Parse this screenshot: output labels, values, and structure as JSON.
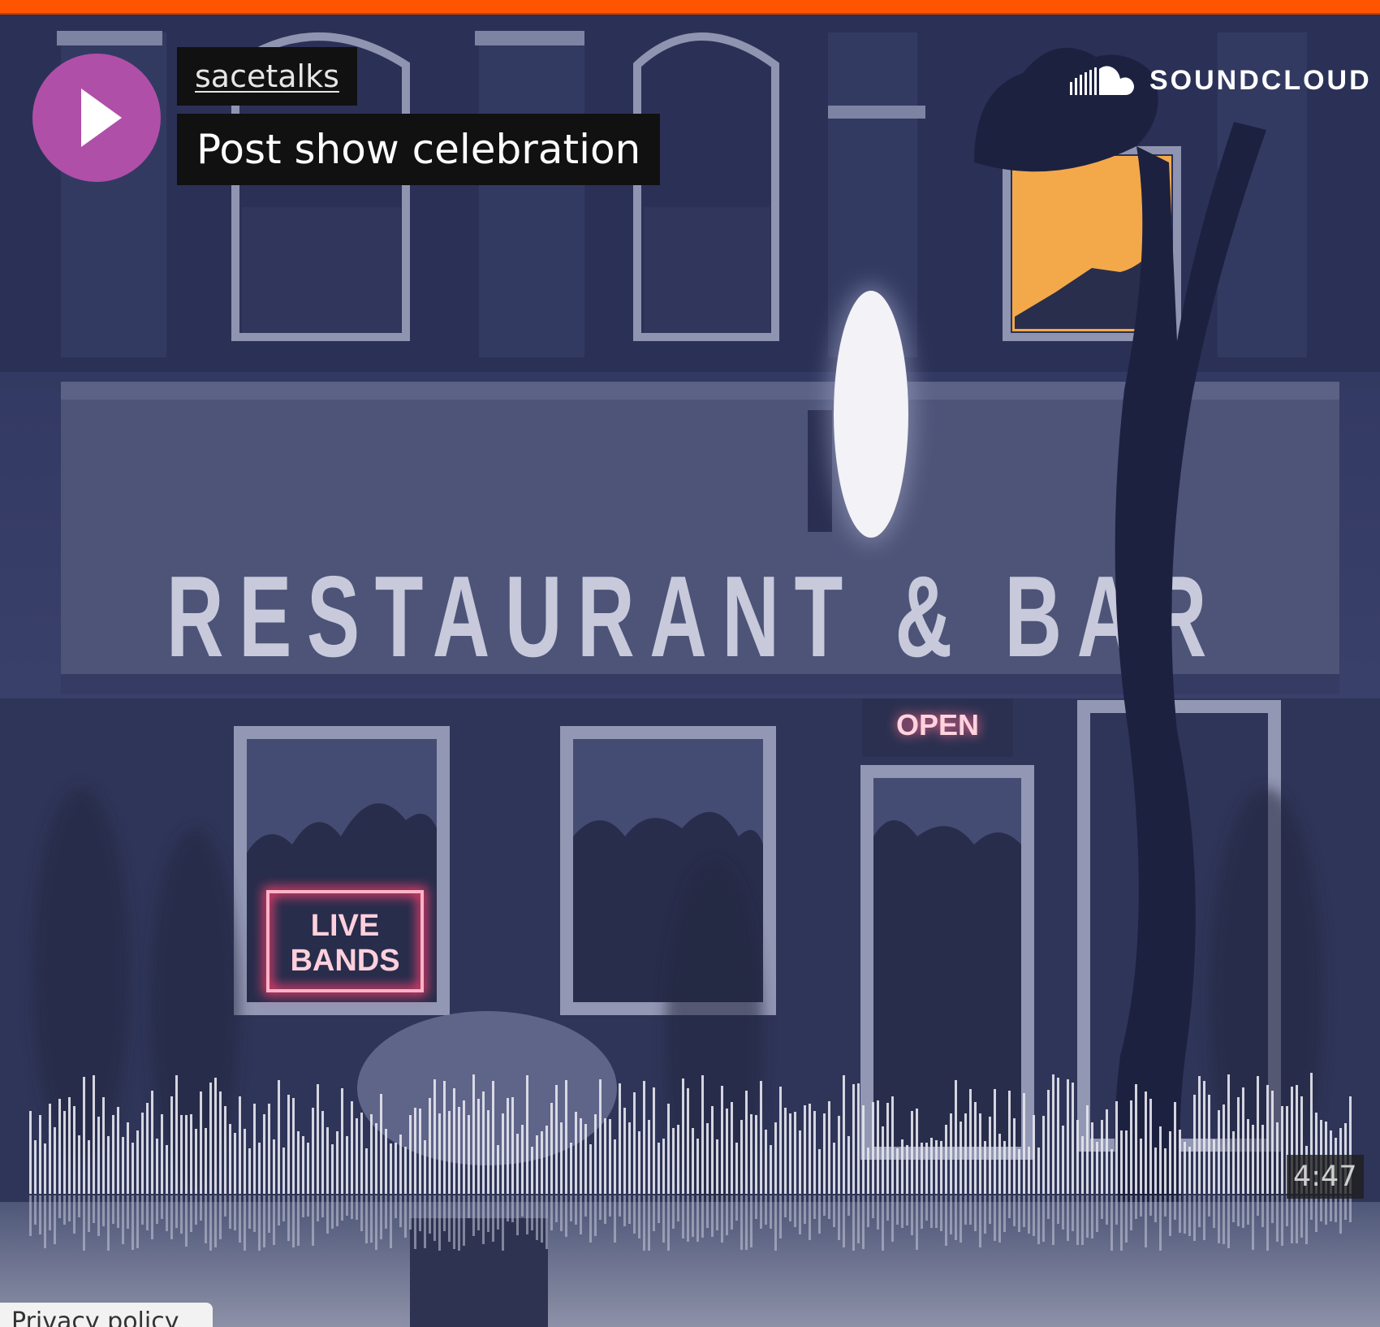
{
  "player": {
    "username": "sacetalks",
    "track_title": "Post show celebration",
    "duration": "4:47",
    "brand": "SOUNDCLOUD",
    "play_icon": "play-icon",
    "privacy_link": "Privacy policy"
  },
  "artwork": {
    "sign_text": "RESTAURANT & BAR",
    "open_sign": "OPEN",
    "live_bands_line1": "LIVE",
    "live_bands_line2": "BANDS"
  },
  "colors": {
    "accent_orange": "#ff5500",
    "play_button": "#b04fa8",
    "neon_pink": "#ff3c6e"
  }
}
